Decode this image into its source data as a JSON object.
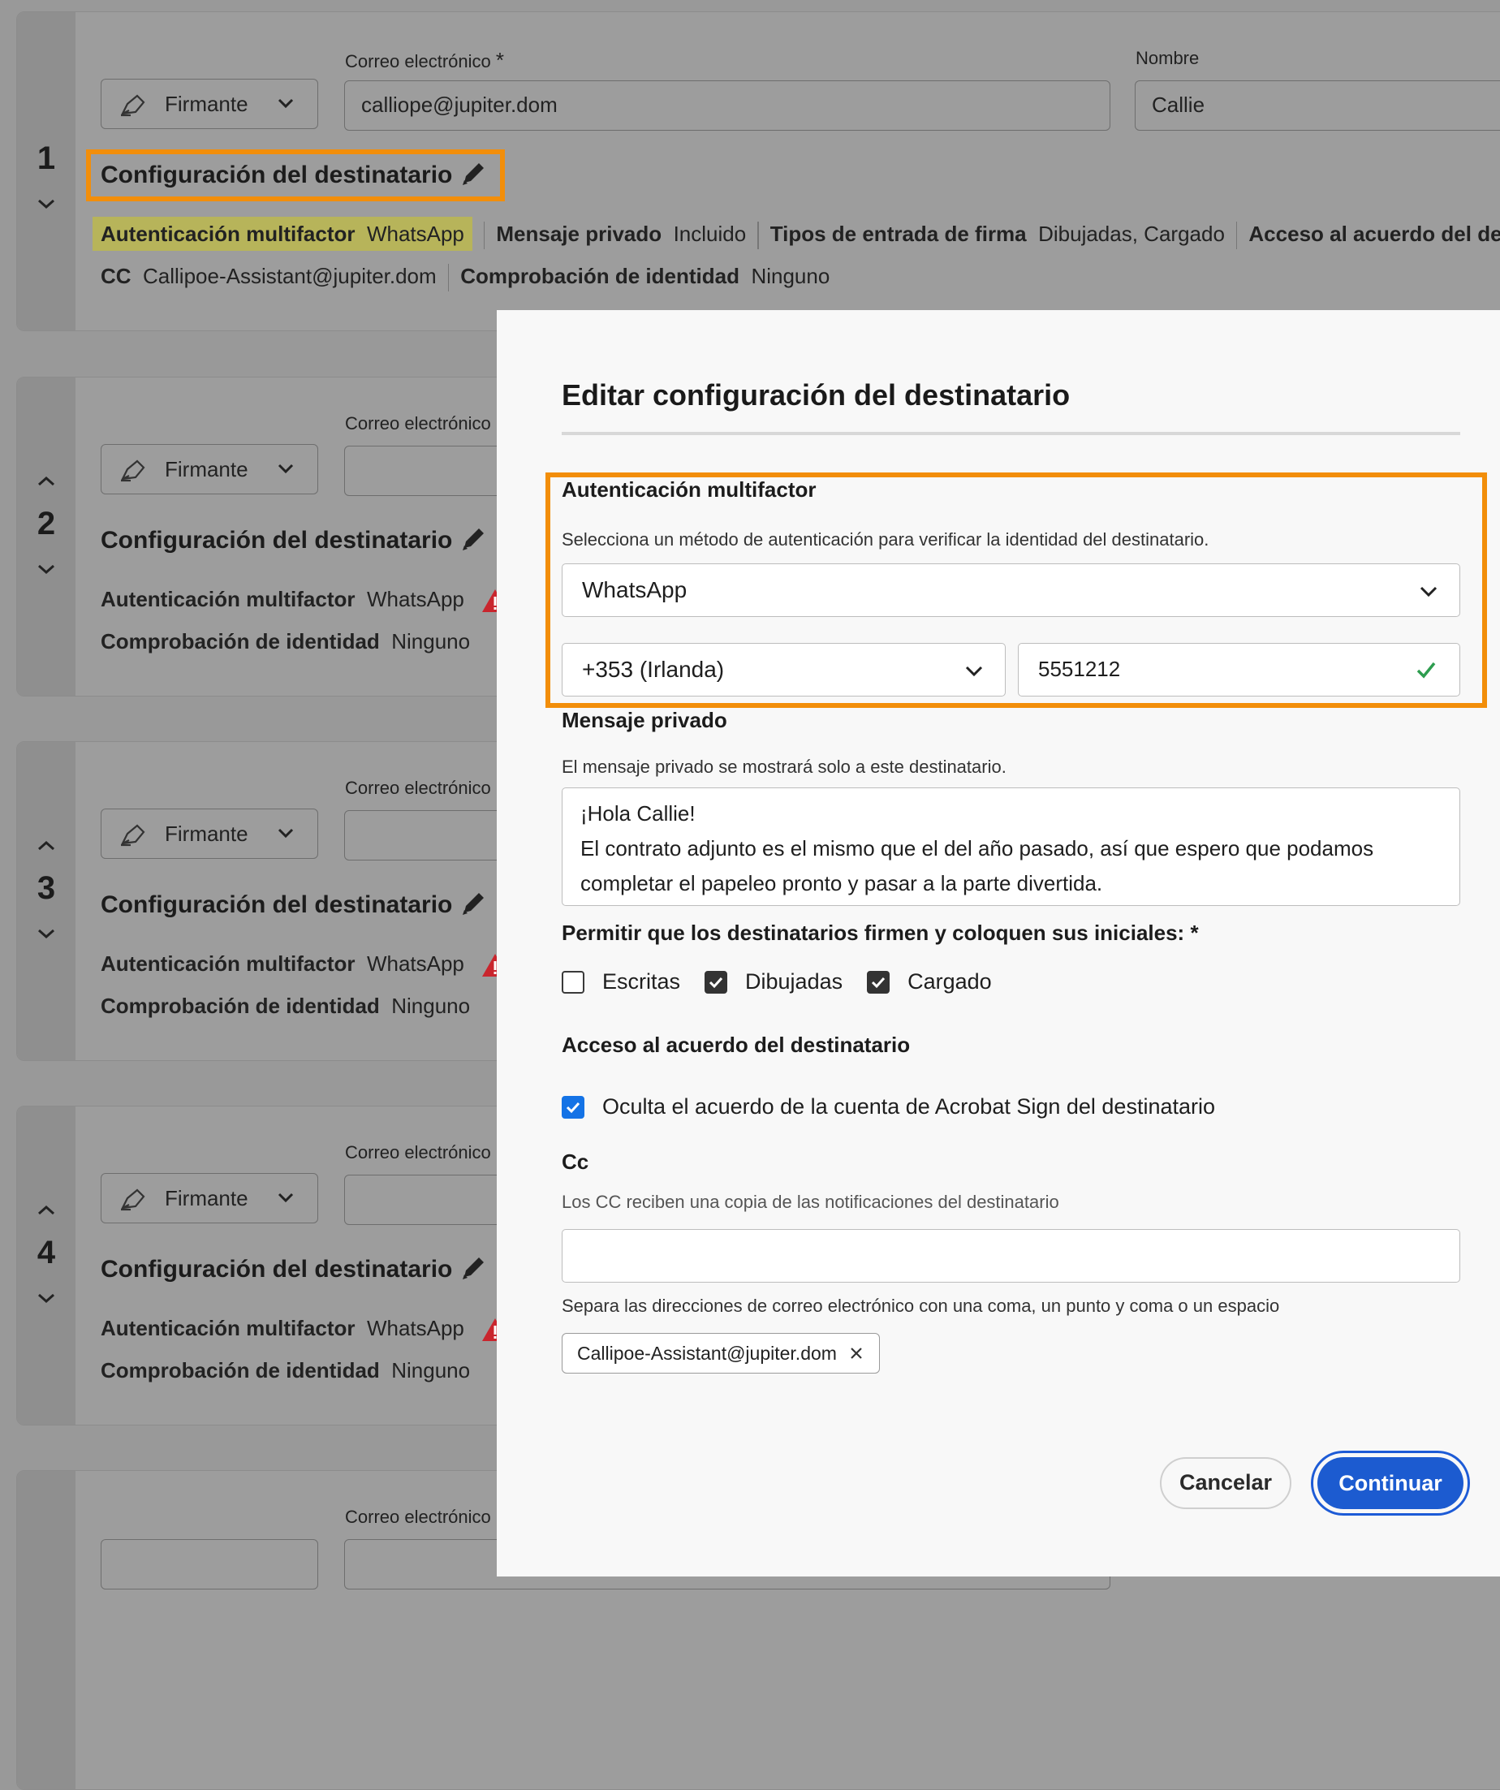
{
  "recipient_list": {
    "email_label": "Correo electrónico",
    "required_mark": "*",
    "name_label": "Nombre",
    "role_label": "Firmante",
    "config_title": "Configuración del destinatario",
    "recipients": [
      {
        "number": "1",
        "email": "calliope@jupiter.dom",
        "name": "Callie",
        "mfa_label": "Autenticación multifactor",
        "mfa_value": "WhatsApp",
        "private_msg_label": "Mensaje privado",
        "private_msg_value": "Incluido",
        "sig_types_label": "Tipos de entrada de firma",
        "sig_types_value": "Dibujadas, Cargado",
        "access_label": "Acceso al acuerdo del destinata",
        "cc_label": "CC",
        "cc_value": "Callipoe-Assistant@jupiter.dom",
        "id_check_label": "Comprobación de identidad",
        "id_check_value": "Ninguno"
      },
      {
        "number": "2",
        "mfa_label": "Autenticación multifactor",
        "mfa_value": "WhatsApp",
        "id_check_label": "Comprobación de identidad",
        "id_check_value": "Ninguno"
      },
      {
        "number": "3",
        "mfa_label": "Autenticación multifactor",
        "mfa_value": "WhatsApp",
        "id_check_label": "Comprobación de identidad",
        "id_check_value": "Ninguno"
      },
      {
        "number": "4",
        "mfa_label": "Autenticación multifactor",
        "mfa_value": "WhatsApp",
        "id_check_label": "Comprobación de identidad",
        "id_check_value": "Ninguno"
      }
    ],
    "partial_card_email_label": "Correo electrónico"
  },
  "modal": {
    "title": "Editar configuración del destinatario",
    "mfa": {
      "heading": "Autenticación multifactor",
      "description": "Selecciona un método de autenticación para verificar la identidad del destinatario.",
      "method": "WhatsApp",
      "country_code": "+353 (Irlanda)",
      "phone": "5551212"
    },
    "private_message": {
      "heading": "Mensaje privado",
      "description": "El mensaje privado se mostrará solo a este destinatario.",
      "text": "¡Hola Callie!\nEl contrato adjunto es el mismo que el del año pasado, así que espero que podamos\ncompletar el papeleo pronto y pasar a la parte divertida."
    },
    "signature_types": {
      "heading": "Permitir que los destinatarios firmen y coloquen sus iniciales: *",
      "options": [
        {
          "label": "Escritas",
          "checked": false
        },
        {
          "label": "Dibujadas",
          "checked": true
        },
        {
          "label": "Cargado",
          "checked": true
        }
      ]
    },
    "access": {
      "heading": "Acceso al acuerdo del destinatario",
      "option_label": "Oculta el acuerdo de la cuenta de Acrobat Sign del destinatario",
      "checked": true
    },
    "cc": {
      "heading": "Cc",
      "description": "Los CC reciben una copia de las notificaciones del destinatario",
      "input_value": "",
      "helper": "Separa las direcciones de correo electrónico con una coma, un punto y coma o un espacio",
      "chips": [
        "Callipoe-Assistant@jupiter.dom"
      ]
    },
    "buttons": {
      "cancel": "Cancelar",
      "continue": "Continuar"
    }
  },
  "colors": {
    "highlight": "#f28e0a",
    "primary": "#1c5bd0",
    "checkbox_blue": "#1473e6",
    "success": "#2d9d4f",
    "warning": "#c9252d"
  },
  "icons": [
    "pen-icon",
    "chevron-down-icon",
    "chevron-up-icon",
    "pencil-icon",
    "warning-icon",
    "checkmark-icon",
    "close-icon"
  ]
}
